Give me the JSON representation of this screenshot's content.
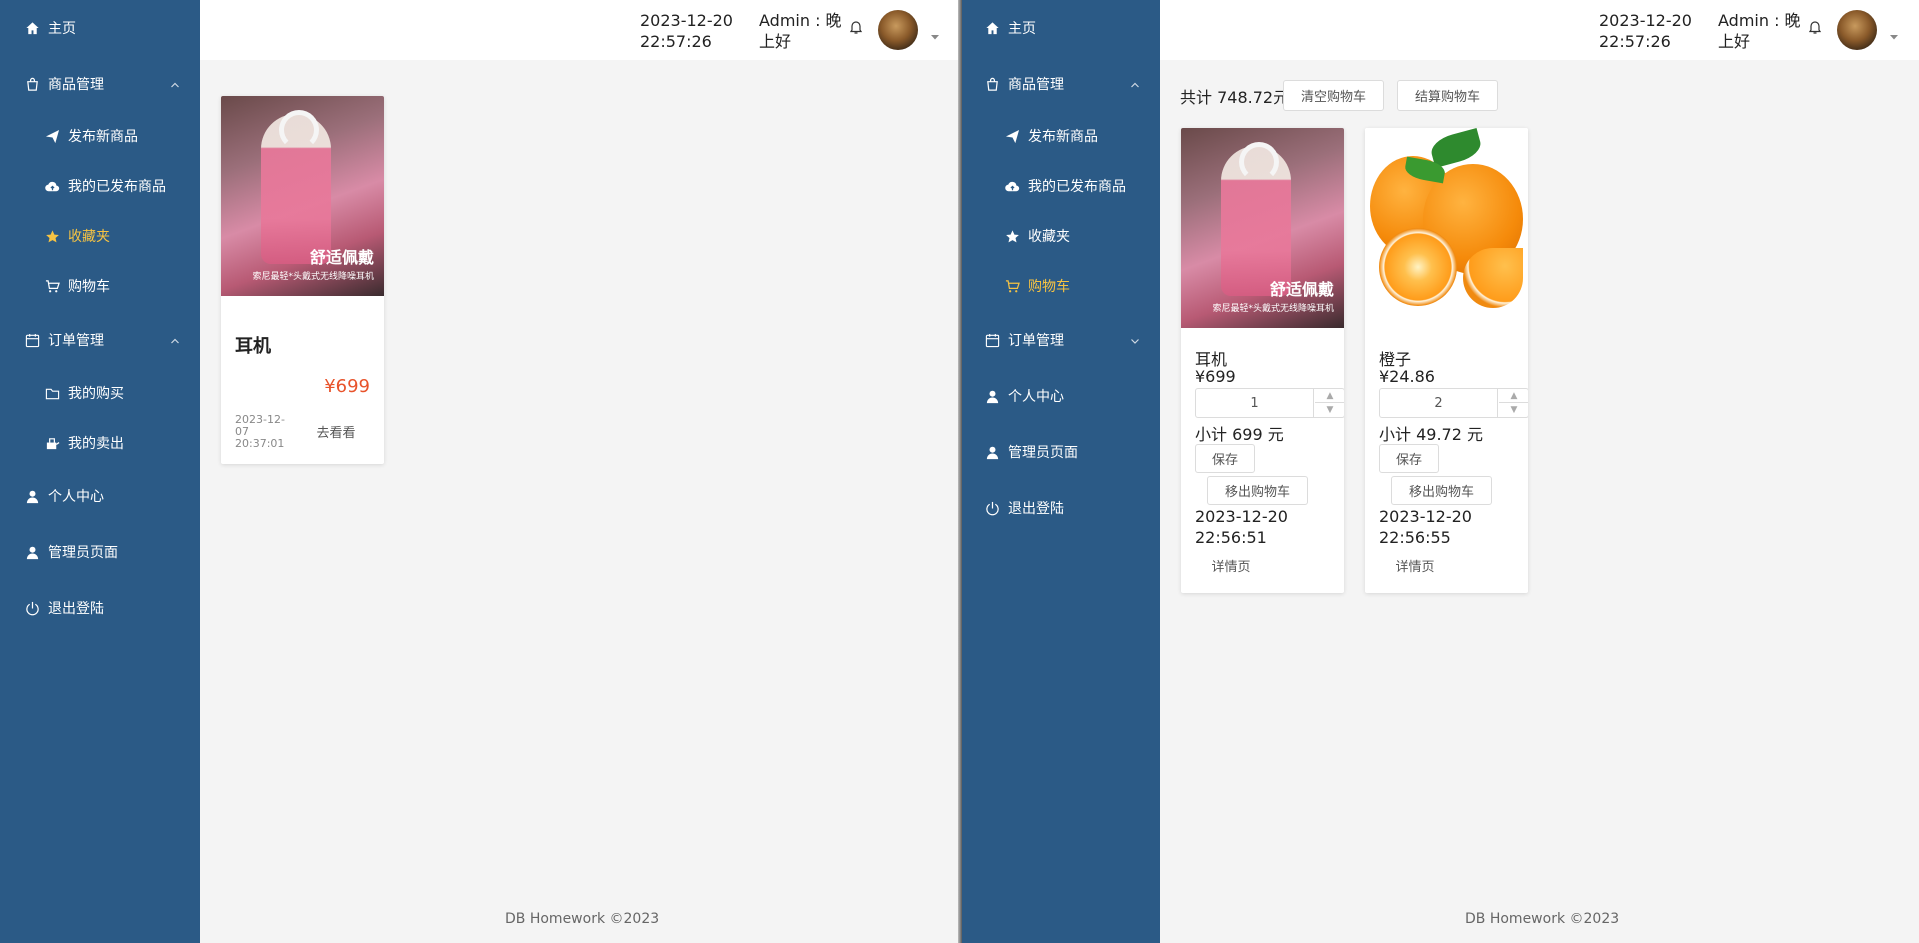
{
  "left": {
    "sidebar": {
      "home": "主页",
      "goods_group": "商品管理",
      "publish": "发布新商品",
      "my_published": "我的已发布商品",
      "favorites": "收藏夹",
      "cart": "购物车",
      "orders_group": "订单管理",
      "my_purchases": "我的购买",
      "my_sales": "我的卖出",
      "profile": "个人中心",
      "admin": "管理员页面",
      "logout": "退出登陆",
      "active_item": "收藏夹"
    },
    "header": {
      "date": "2023-12-20",
      "time": "22:57:26",
      "user_line1": "Admin : 晚",
      "user_line2": "上好"
    },
    "favorite_card": {
      "title": "耳机",
      "price": "¥699",
      "date_line1": "2023-12-",
      "date_line2": "07",
      "date_line3": "20:37:01",
      "goto_label": "去看看",
      "photo_caption": "舒适佩戴",
      "photo_subcaption": "索尼最轻*头戴式无线降噪耳机"
    },
    "footer": "DB Homework ©2023"
  },
  "right": {
    "sidebar": {
      "home": "主页",
      "goods_group": "商品管理",
      "publish": "发布新商品",
      "my_published": "我的已发布商品",
      "favorites": "收藏夹",
      "cart": "购物车",
      "orders_group": "订单管理",
      "profile": "个人中心",
      "admin": "管理员页面",
      "logout": "退出登陆",
      "active_item": "购物车"
    },
    "header": {
      "date": "2023-12-20",
      "time": "22:57:26",
      "user_line1": "Admin : 晚",
      "user_line2": "上好"
    },
    "cart_bar": {
      "total": "共计 748.72元",
      "clear_label": "清空购物车",
      "checkout_label": "结算购物车"
    },
    "cart_items": [
      {
        "name": "耳机",
        "price": "¥699",
        "quantity": "1",
        "subtotal": "小计 699 元",
        "save_label": "保存",
        "remove_label": "移出购物车",
        "date": "2023-12-20",
        "time": "22:56:51",
        "detail_label": "详情页",
        "photo_caption": "舒适佩戴",
        "photo_subcaption": "索尼最轻*头戴式无线降噪耳机"
      },
      {
        "name": "橙子",
        "price": "¥24.86",
        "quantity": "2",
        "subtotal": "小计 49.72 元",
        "save_label": "保存",
        "remove_label": "移出购物车",
        "date": "2023-12-20",
        "time": "22:56:55",
        "detail_label": "详情页"
      }
    ],
    "footer": "DB Homework ©2023"
  },
  "colors": {
    "sidebar_bg": "#2b5a86",
    "active_text": "#f6c343",
    "price_red": "#e8532b"
  },
  "icons": [
    "home-icon",
    "bag-icon",
    "send-icon",
    "cloud-upload-icon",
    "star-icon",
    "cart-icon",
    "calendar-icon",
    "folder-icon",
    "sell-icon",
    "user-icon",
    "power-icon",
    "bell-icon",
    "caret-down-icon",
    "chevron-up-icon",
    "chevron-down-icon"
  ]
}
